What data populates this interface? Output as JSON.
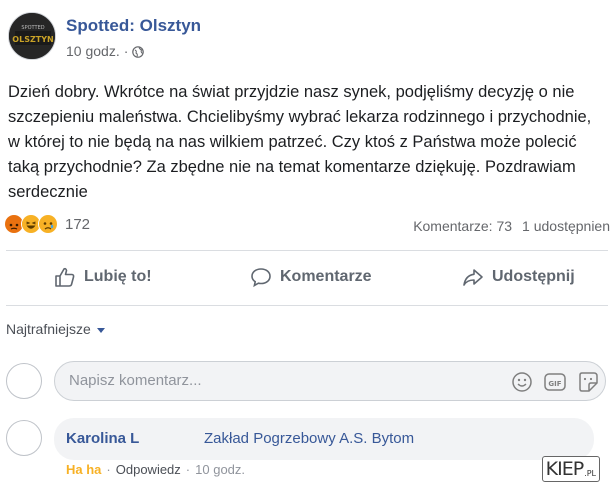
{
  "post": {
    "page_name": "Spotted: Olsztyn",
    "time": "10 godz.",
    "time_separator": "·",
    "visibility_icon": "globe-icon",
    "text": "Dzień dobry. Wkrótce na świat przyjdzie nasz synek, podjęliśmy decyzję o nie szczepieniu maleństwa. Chcielibyśmy wybrać lekarza rodzinnego i przychodnie, w której to nie będą na nas wilkiem patrzeć. Czy ktoś z Państwa może polecić taką przychodnie? Za zbędne nie na temat komentarze dziękuję. Pozdrawiam serdecznie"
  },
  "reactions": {
    "icons": [
      "angry-reaction-icon",
      "haha-reaction-icon",
      "sad-reaction-icon"
    ],
    "count": "172",
    "comments": "Komentarze: 73",
    "shares": "1 udostępnien"
  },
  "actions": {
    "like": "Lubię to!",
    "comment": "Komentarze",
    "share": "Udostępnij"
  },
  "sort": {
    "label": "Najtrafniejsze"
  },
  "composer": {
    "placeholder": "Napisz komentarz...",
    "icons": [
      "emoji-icon",
      "gif-icon",
      "sticker-icon"
    ]
  },
  "comment": {
    "author": "Karolina L",
    "text": "Zakład Pogrzebowy A.S. Bytom",
    "reaction": "Ha ha",
    "reply": "Odpowiedz",
    "separator": "·",
    "time": "10 godz."
  },
  "watermark": {
    "main": "KIEP",
    "suffix": ".PL"
  },
  "colors": {
    "link": "#385898",
    "muted": "#65676b",
    "bubble": "#f2f3f5",
    "haha": "#f7b125",
    "angry": "#e9710f",
    "divider": "#dadde1"
  }
}
